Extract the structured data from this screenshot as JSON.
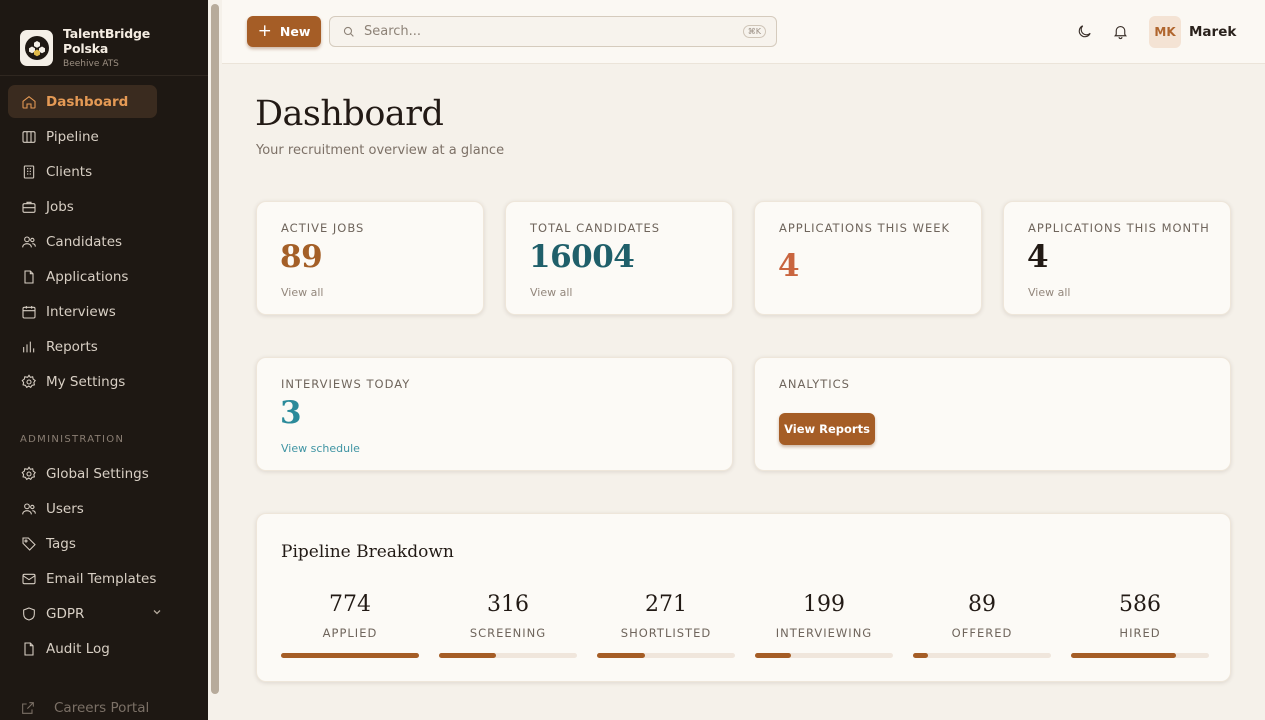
{
  "brand": {
    "name": "TalentBridge Polska",
    "subtitle": "Beehive ATS"
  },
  "nav": {
    "items": [
      {
        "label": "Dashboard",
        "icon": "home-icon",
        "active": true
      },
      {
        "label": "Pipeline",
        "icon": "columns-icon"
      },
      {
        "label": "Clients",
        "icon": "building-icon"
      },
      {
        "label": "Jobs",
        "icon": "briefcase-icon"
      },
      {
        "label": "Candidates",
        "icon": "users-icon"
      },
      {
        "label": "Applications",
        "icon": "file-icon"
      },
      {
        "label": "Interviews",
        "icon": "calendar-icon"
      },
      {
        "label": "Reports",
        "icon": "bar-chart-icon"
      },
      {
        "label": "My Settings",
        "icon": "gear-icon"
      }
    ],
    "admin_label": "ADMINISTRATION",
    "admin_items": [
      {
        "label": "Global Settings",
        "icon": "gear-icon"
      },
      {
        "label": "Users",
        "icon": "users-icon"
      },
      {
        "label": "Tags",
        "icon": "tag-icon"
      },
      {
        "label": "Email Templates",
        "icon": "mail-icon"
      },
      {
        "label": "GDPR",
        "icon": "shield-icon"
      },
      {
        "label": "Audit Log",
        "icon": "file-icon"
      }
    ],
    "careers_label": "Careers Portal"
  },
  "topbar": {
    "new_label": "New",
    "search_placeholder": "Search...",
    "shortcut": "⌘K",
    "avatar_initials": "MK",
    "user_name": "Marek"
  },
  "header": {
    "title": "Dashboard",
    "subtitle": "Your recruitment overview at a glance"
  },
  "stats": [
    {
      "label": "ACTIVE JOBS",
      "value": "89",
      "link": "View all",
      "color": "#a45f27"
    },
    {
      "label": "TOTAL CANDIDATES",
      "value": "16004",
      "link": "View all",
      "color": "#1f5f6a"
    },
    {
      "label": "APPLICATIONS THIS WEEK",
      "value": "4",
      "link": "",
      "color": "#c9653f"
    },
    {
      "label": "APPLICATIONS THIS MONTH",
      "value": "4",
      "link": "View all",
      "color": "#221a15"
    }
  ],
  "interviews": {
    "label": "INTERVIEWS TODAY",
    "value": "3",
    "link": "View schedule",
    "color": "#2b8a9a"
  },
  "analytics": {
    "label": "ANALYTICS",
    "button": "View Reports"
  },
  "pipeline": {
    "title": "Pipeline Breakdown",
    "stages": [
      {
        "count": "774",
        "name": "APPLIED",
        "fill": 1.0
      },
      {
        "count": "316",
        "name": "SCREENING",
        "fill": 0.41
      },
      {
        "count": "271",
        "name": "SHORTLISTED",
        "fill": 0.35
      },
      {
        "count": "199",
        "name": "INTERVIEWING",
        "fill": 0.26
      },
      {
        "count": "89",
        "name": "OFFERED",
        "fill": 0.11
      },
      {
        "count": "586",
        "name": "HIRED",
        "fill": 0.76
      }
    ]
  }
}
